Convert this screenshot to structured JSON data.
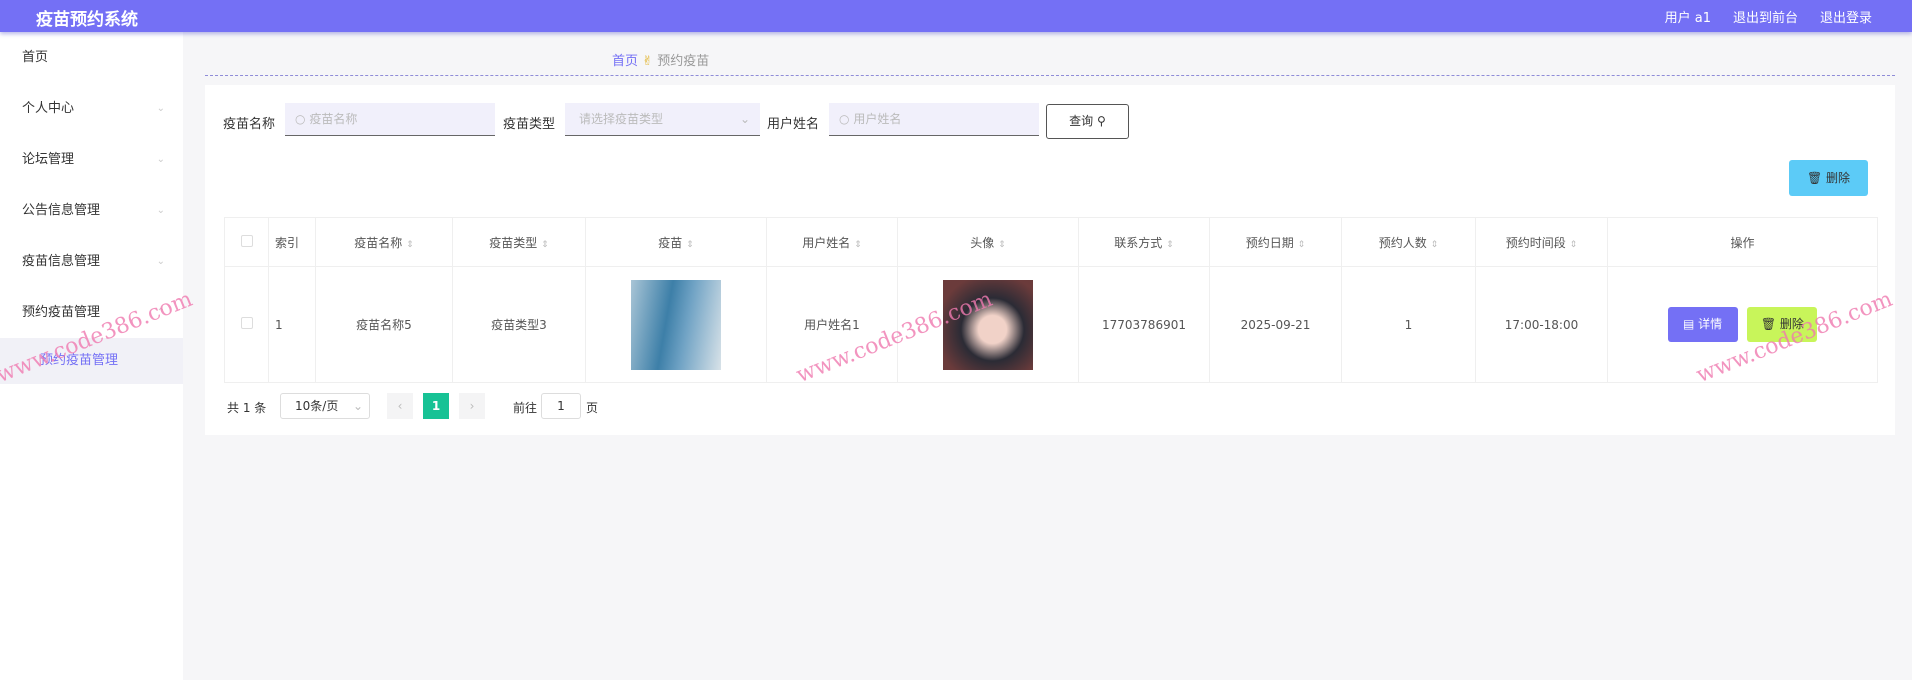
{
  "header": {
    "title": "疫苗预约系统",
    "user": "用户 a1",
    "to_front": "退出到前台",
    "logout": "退出登录"
  },
  "sidebar": {
    "items": [
      {
        "label": "首页"
      },
      {
        "label": "个人中心"
      },
      {
        "label": "论坛管理"
      },
      {
        "label": "公告信息管理"
      },
      {
        "label": "疫苗信息管理"
      },
      {
        "label": "预约疫苗管理"
      },
      {
        "label": "预约疫苗管理"
      }
    ]
  },
  "breadcrumb": {
    "home": "首页",
    "current": "预约疫苗"
  },
  "search": {
    "name_label": "疫苗名称",
    "name_placeholder": "疫苗名称",
    "type_label": "疫苗类型",
    "type_placeholder": "请选择疫苗类型",
    "user_label": "用户姓名",
    "user_placeholder": "用户姓名",
    "query": "查询"
  },
  "toolbar": {
    "delete": "删除"
  },
  "table": {
    "headers": [
      "索引",
      "疫苗名称",
      "疫苗类型",
      "疫苗",
      "用户姓名",
      "头像",
      "联系方式",
      "预约日期",
      "预约人数",
      "预约时间段",
      "操作"
    ],
    "rows": [
      {
        "index": "1",
        "name": "疫苗名称5",
        "type": "疫苗类型3",
        "user": "用户姓名1",
        "phone": "17703786901",
        "date": "2025-09-21",
        "count": "1",
        "slot": "17:00-18:00"
      }
    ],
    "detail": "详情",
    "delete": "删除"
  },
  "pagination": {
    "total": "共 1 条",
    "size": "10条/页",
    "page": "1",
    "goto": "前往",
    "goto_value": "1",
    "page_unit": "页"
  },
  "watermark": "www.code386.com",
  "colors": {
    "primary": "#7470f5",
    "delete_top": "#5ccbf7",
    "delete_row": "#c8f55a",
    "page_active": "#17c295"
  }
}
